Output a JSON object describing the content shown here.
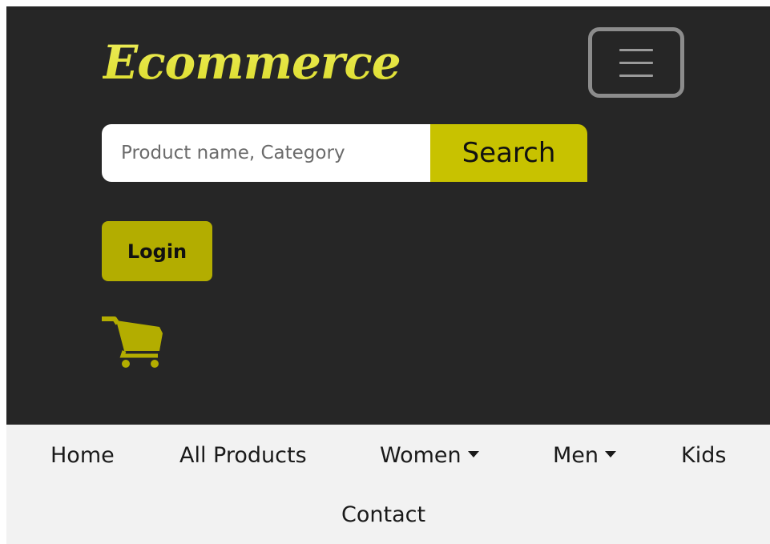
{
  "header": {
    "logo_text": "Ecommerce",
    "toggler_icon": "hamburger-icon"
  },
  "search": {
    "placeholder": "Product name, Category",
    "button_label": "Search"
  },
  "account": {
    "login_label": "Login"
  },
  "cart": {
    "icon": "cart-icon"
  },
  "nav": {
    "items": [
      {
        "label": "Home"
      },
      {
        "label": "All Products"
      },
      {
        "label": "Women",
        "dropdown": true
      },
      {
        "label": "Men",
        "dropdown": true
      },
      {
        "label": "Kids"
      },
      {
        "label": "Contact"
      }
    ]
  },
  "colors": {
    "header_bg": "#262626",
    "accent": "#c8c200",
    "logo": "#e6e63a",
    "nav_bg": "#f2f2f2"
  }
}
